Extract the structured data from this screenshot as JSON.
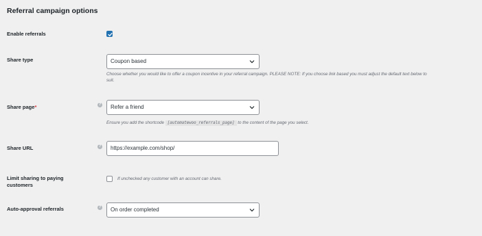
{
  "section_title": "Referral campaign options",
  "enable_referrals": {
    "label": "Enable referrals",
    "checked": true
  },
  "share_type": {
    "label": "Share type",
    "value": "Coupon based",
    "description": "Choose whether you would like to offer a coupon incentive in your referral campaign. PLEASE NOTE: If you choose link based you must adjust the default text below to suit."
  },
  "share_page": {
    "label": "Share page",
    "required_mark": "*",
    "value": "Refer a friend",
    "desc_before": "Ensure you add the shortcode",
    "shortcode": "[automatewoo_referrals_page]",
    "desc_after": "to the content of the page you select."
  },
  "share_url": {
    "label": "Share URL",
    "value": "https://example.com/shop/"
  },
  "limit_sharing": {
    "label": "Limit sharing to paying customers",
    "checked": false,
    "description": "If unchecked any customer with an account can share."
  },
  "auto_approval": {
    "label": "Auto-approval referrals",
    "value": "On order completed"
  },
  "icons": {
    "help": "help-icon",
    "dropdown": "chevron-down-icon",
    "check": "checkmark-icon"
  },
  "colors": {
    "accent": "#2271b1",
    "required": "#d63638",
    "background": "#f0f0f1"
  }
}
